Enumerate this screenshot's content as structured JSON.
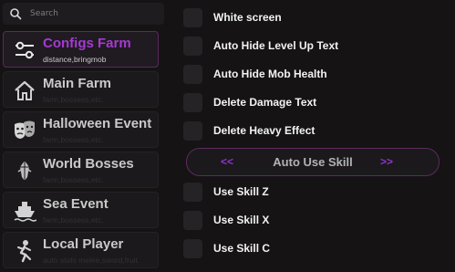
{
  "search": {
    "placeholder": "Search",
    "value": ""
  },
  "sidebar": {
    "items": [
      {
        "label": "Configs Farm",
        "sub": "distance,bringmob",
        "icon": "sliders-icon",
        "active": true
      },
      {
        "label": "Main Farm",
        "sub": "farm,bossess,etc.",
        "icon": "home-icon",
        "active": false
      },
      {
        "label": "Halloween Event",
        "sub": "farm,bossess,etc.",
        "icon": "theater-masks-icon",
        "active": false
      },
      {
        "label": "World Bosses",
        "sub": "farm,bossess,etc.",
        "icon": "crystal-icon",
        "active": false
      },
      {
        "label": "Sea Event",
        "sub": "farm,bossess,etc.",
        "icon": "ship-icon",
        "active": false
      },
      {
        "label": "Local Player",
        "sub": "auto stats melee,sword,fruit",
        "icon": "person-icon",
        "active": false
      }
    ]
  },
  "main": {
    "toggles_top": [
      {
        "label": "White screen",
        "checked": false
      },
      {
        "label": "Auto Hide Level Up Text",
        "checked": false
      },
      {
        "label": "Auto Hide Mob Health",
        "checked": false
      },
      {
        "label": "Delete Damage Text",
        "checked": false
      },
      {
        "label": "Delete Heavy Effect",
        "checked": false
      }
    ],
    "section": {
      "left_arrow": "<<",
      "title": "Auto Use Skill",
      "right_arrow": ">>"
    },
    "toggles_bottom": [
      {
        "label": "Use Skill Z",
        "checked": false
      },
      {
        "label": "Use Skill X",
        "checked": false
      },
      {
        "label": "Use Skill C",
        "checked": false
      }
    ]
  },
  "colors": {
    "background": "#151314",
    "panel": "#1b191c",
    "accent_purple": "#a53ad2",
    "accent_border": "#5e2a5f",
    "checkbox": "#252326",
    "text_primary": "#f2f2f2"
  }
}
